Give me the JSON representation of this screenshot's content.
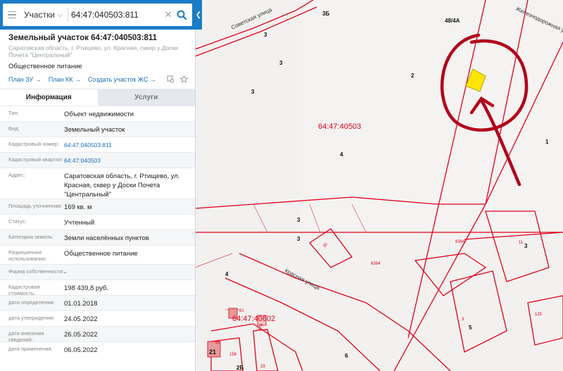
{
  "search": {
    "type_label": "Участки",
    "query": "64:47:040503:811"
  },
  "object": {
    "title": "Земельный участок 64:47:040503:811",
    "address_line": "Саратовская область, г. Ртищево, ул. Красная, сквер у Доски Почета \"Центральный\"",
    "use": "Общественное питание",
    "links": [
      "План ЗУ →",
      "План КК →",
      "Создать участок ЖС →"
    ]
  },
  "tabs": [
    "Информация",
    "Услуги"
  ],
  "rows": [
    {
      "label": "Тип:",
      "value": "Объект недвижимости"
    },
    {
      "label": "Вид:",
      "value": "Земельный участок"
    },
    {
      "label": "Кадастровый номер:",
      "value": "64:47:040503:811",
      "link": true
    },
    {
      "label": "Кадастровый квартал:",
      "value": "64:47:040503",
      "link": true
    },
    {
      "label": "Адрес:",
      "value": "Саратовская область, г. Ртищево, ул. Красная, сквер у Доски Почета \"Центральный\""
    },
    {
      "label": "Площадь уточненная:",
      "value": "169 кв. м"
    },
    {
      "label": "Статус:",
      "value": "Учтенный"
    },
    {
      "label": "Категория земель:",
      "value": "Земли населённых пунктов"
    },
    {
      "label": "Разрешенное использование:",
      "value": "Общественное питание"
    },
    {
      "label": "Форма собственности:",
      "value": "-"
    },
    {
      "label": "Кадастровая стоимость:",
      "value": "198 439,8 руб."
    },
    {
      "label": "дата определения:",
      "value": "01.01.2018"
    },
    {
      "label": "дата утверждения:",
      "value": "24.05.2022"
    },
    {
      "label": "дата внесения сведений:",
      "value": "26.05.2022"
    },
    {
      "label": "дата применения:",
      "value": "06.05.2022"
    }
  ],
  "map": {
    "quarter_label": "64:47:40503",
    "quarter_label_2": "64:47:40602",
    "streets": [
      "Советская улица",
      "Железнодорожная у",
      "Красная улица"
    ],
    "numbers": [
      "3Б",
      "48/4А",
      "3",
      "3",
      "3",
      "2",
      "4",
      "1",
      "3",
      "3",
      "3",
      "4",
      "5",
      "6",
      "21",
      "2Б",
      "35",
      "6394",
      "6394",
      "11",
      "3",
      "125",
      "22",
      "158",
      "179",
      "25",
      "29"
    ],
    "colors": {
      "boundary": "#e2001a",
      "parcel": "#ffe600",
      "annotation": "#b3001b"
    }
  }
}
